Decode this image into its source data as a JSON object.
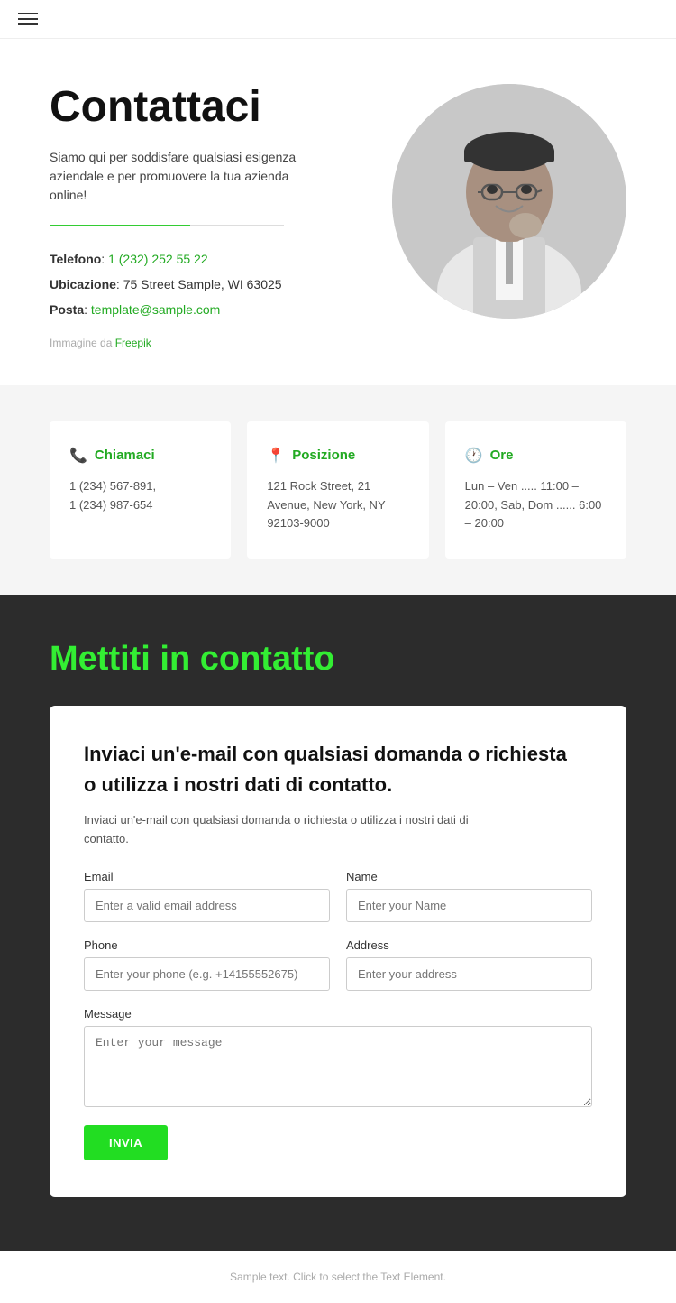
{
  "nav": {
    "hamburger_label": "Menu"
  },
  "hero": {
    "title": "Contattaci",
    "subtitle": "Siamo qui per soddisfare qualsiasi esigenza aziendale e per promuovere la tua azienda online!",
    "divider": true,
    "telefono_label": "Telefono",
    "telefono_value": "1 (232) 252 55 22",
    "ubicazione_label": "Ubicazione",
    "ubicazione_value": "75 Street Sample, WI 63025",
    "posta_label": "Posta",
    "posta_value": "template@sample.com",
    "image_credit_prefix": "Immagine da",
    "image_credit_link": "Freepik"
  },
  "cards": [
    {
      "icon": "📞",
      "label": "Chiamaci",
      "lines": [
        "1 (234) 567-891,",
        "1 (234) 987-654"
      ]
    },
    {
      "icon": "📍",
      "label": "Posizione",
      "lines": [
        "121 Rock Street, 21 Avenue, New York, NY 92103-9000"
      ]
    },
    {
      "icon": "🕐",
      "label": "Ore",
      "lines": [
        "Lun – Ven ..... 11:00 – 20:00, Sab, Dom  ...... 6:00 – 20:00"
      ]
    }
  ],
  "contact_section": {
    "title": "Mettiti in contatto",
    "form": {
      "heading_line1": "Inviaci un'e-mail con qualsiasi domanda o richiesta",
      "heading_line2": "o utilizza i nostri dati di contatto.",
      "description": "Inviaci un'e-mail con qualsiasi domanda o richiesta o utilizza i nostri dati di contatto.",
      "email_label": "Email",
      "email_placeholder": "Enter a valid email address",
      "name_label": "Name",
      "name_placeholder": "Enter your Name",
      "phone_label": "Phone",
      "phone_placeholder": "Enter your phone (e.g. +14155552675)",
      "address_label": "Address",
      "address_placeholder": "Enter your address",
      "message_label": "Message",
      "message_placeholder": "Enter your message",
      "submit_label": "INVIA"
    }
  },
  "footer": {
    "text": "Sample text. Click to select the Text Element."
  }
}
